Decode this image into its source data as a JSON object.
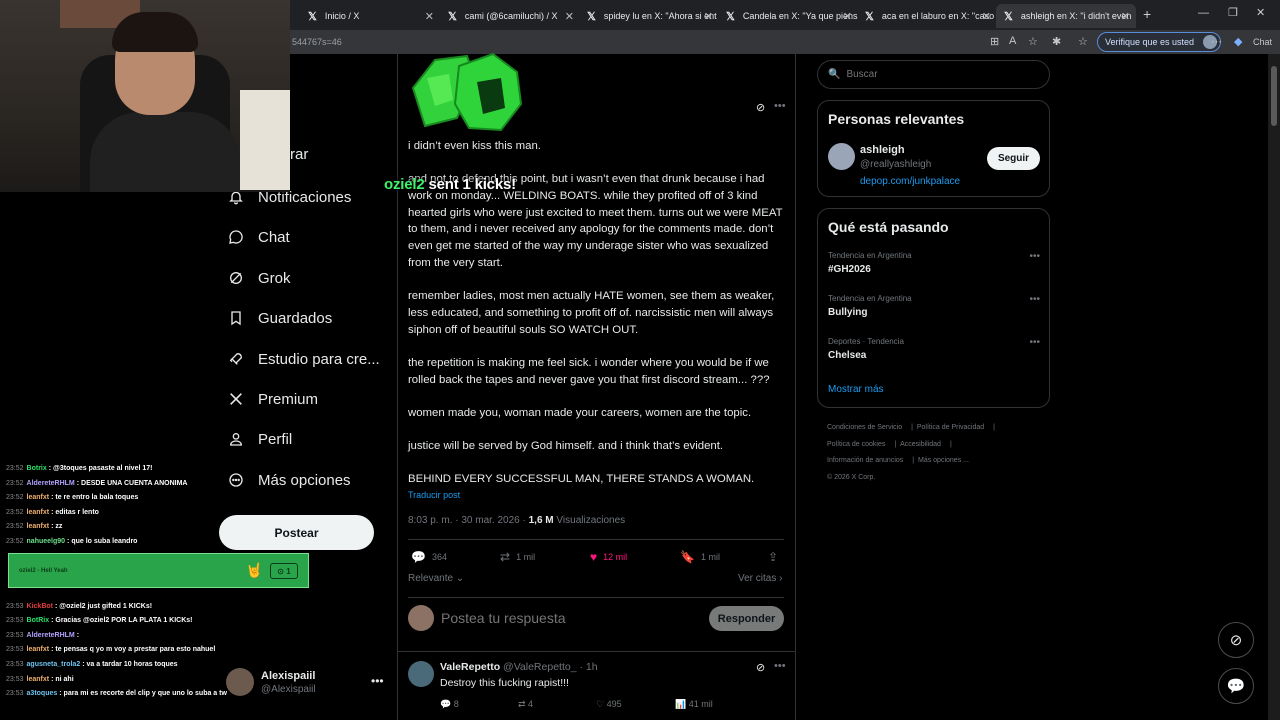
{
  "browser": {
    "tabs": [
      {
        "label": "Inicio / X"
      },
      {
        "label": "cami (@6camiluchi) / X"
      },
      {
        "label": "spidey lu en X: \"Ahora si ent"
      },
      {
        "label": "Candela en X: \"Ya que piens"
      },
      {
        "label": "aca en el laburo en X: \"caso"
      },
      {
        "label": "ashleigh en X: \"i didn't even"
      }
    ],
    "url_fragment": "544767s=46",
    "verify_label": "Verifique que es usted",
    "chat_label": "Chat"
  },
  "nav": {
    "explore_partial": "rar",
    "items": [
      {
        "label": "Notificaciones",
        "icon": "bell-icon"
      },
      {
        "label": "Chat",
        "icon": "chat-icon"
      },
      {
        "label": "Grok",
        "icon": "grok-icon"
      },
      {
        "label": "Guardados",
        "icon": "bookmark-icon"
      },
      {
        "label": "Estudio para cre...",
        "icon": "rocket-icon"
      },
      {
        "label": "Premium",
        "icon": "x-icon"
      },
      {
        "label": "Perfil",
        "icon": "person-icon"
      },
      {
        "label": "Más opciones",
        "icon": "more-circle-icon"
      }
    ],
    "post_label": "Postear",
    "account": {
      "name": "Alexispaiil",
      "handle": "@Alexispaiil"
    }
  },
  "stream_overlay": {
    "kicks_user": "oziel2",
    "kicks_text": "sent 1 kicks!",
    "gift_banner": {
      "text": "- Hell Yeah",
      "count": "1"
    },
    "chat": [
      {
        "ts": "23:52",
        "user": "Botrix",
        "color": "#2ee06a",
        "msg": ": @3toques pasaste al nivel 17!"
      },
      {
        "ts": "23:52",
        "user": "AldereteRHLM",
        "color": "#b4a2ff",
        "msg": ": DESDE UNA CUENTA ANONIMA"
      },
      {
        "ts": "23:52",
        "user": "leanfxt",
        "color": "#f0b070",
        "msg": ": te re entro la bala toques"
      },
      {
        "ts": "23:52",
        "user": "leanfxt",
        "color": "#f0b070",
        "msg": ": editas r lento"
      },
      {
        "ts": "23:52",
        "user": "leanfxt",
        "color": "#f0b070",
        "msg": ": zz"
      },
      {
        "ts": "23:52",
        "user": "nahueelg90",
        "color": "#6ee08a",
        "msg": ": que lo suba leandro"
      },
      {
        "ts": "23:52",
        "user": "",
        "color": "#fff",
        "msg": ""
      },
      {
        "ts": "23:52",
        "user": "",
        "color": "#fff",
        "msg": ""
      },
      {
        "ts": "23:53",
        "user": "KickBot",
        "color": "#e23c3c",
        "msg": ": @oziel2 just gifted 1 KICKs!"
      },
      {
        "ts": "23:53",
        "user": "BotRix",
        "color": "#2ee06a",
        "msg": ": Gracias @oziel2 POR LA PLATA 1 KICKs!"
      },
      {
        "ts": "23:53",
        "user": "AldereteRHLM",
        "color": "#b4a2ff",
        "msg": ":"
      },
      {
        "ts": "23:53",
        "user": "leanfxt",
        "color": "#f0b070",
        "msg": ": te pensas q yo m voy a prestar para esto nahuel"
      },
      {
        "ts": "23:53",
        "user": "agusneta_trola2",
        "color": "#6ec3f0",
        "msg": ": va a tardar 10 horas toques"
      },
      {
        "ts": "23:53",
        "user": "leanfxt",
        "color": "#f0b070",
        "msg": ": ni ahi"
      },
      {
        "ts": "23:53",
        "user": "a3toques",
        "color": "#6ec3f0",
        "msg": ": para mi es recorte del clip y que uno lo suba a tw"
      }
    ]
  },
  "tweet": {
    "paragraphs": [
      "i didn’t even kiss this man.",
      "and not to defend this point, but i wasn’t even that drunk because i had work on monday... WELDING BOATS. while they profited off of 3 kind hearted girls who were just excited to meet them. turns out we were MEAT to them, and i never received any apology for the comments made. don’t even get me started of the way my underage sister who was sexualized from the very start.",
      "remember ladies, most men actually HATE women, see them as weaker, less educated, and something to profit off of. narcissistic men will always siphon off of beautiful souls SO WATCH OUT.",
      "the repetition is making me feel sick. i wonder where you would be if we rolled back the tapes and never gave you that first discord stream... ???",
      "women made you, woman made your careers, women are the topic.",
      "justice will be served by God himself. and i think that’s evident.",
      "BEHIND EVERY SUCCESSFUL MAN, THERE STANDS A WOMAN."
    ],
    "translate": "Traducir post",
    "timestamp": "8:03 p. m. · 30 mar. 2026 · ",
    "views_count": "1,6 M",
    "views_label": " Visualizaciones",
    "replies": "364",
    "reposts": "1 mil",
    "likes": "12 mil",
    "bookmarks": "1 mil",
    "sort_label": "Relevante",
    "view_quotes": "Ver citas",
    "reply_placeholder": "Postea tu respuesta",
    "reply_button": "Responder"
  },
  "reply": {
    "name": "ValeRepetto",
    "handle": "@ValeRepetto_",
    "time": "· 1h",
    "text": "Destroy this fucking rapist!!!",
    "replies": "8",
    "reposts": "4",
    "likes": "495",
    "views": "41 mil"
  },
  "sidebar": {
    "search_placeholder": "Buscar",
    "relevant_title": "Personas relevantes",
    "person": {
      "name": "ashleigh",
      "handle": "@reallyashleigh",
      "link": "depop.com/junkpalace",
      "follow": "Seguir"
    },
    "trending_title": "Qué está pasando",
    "trends": [
      {
        "context": "Tendencia en Argentina",
        "topic": "#GH2026"
      },
      {
        "context": "Tendencia en Argentina",
        "topic": "Bullying"
      },
      {
        "context": "Deportes · Tendencia",
        "topic": "Chelsea"
      }
    ],
    "show_more": "Mostrar más",
    "footer": [
      "Condiciones de Servicio",
      "Política de Privacidad",
      "Política de cookies",
      "Accesibilidad",
      "Información de anuncios",
      "Más opciones ...",
      "© 2026 X Corp."
    ]
  }
}
